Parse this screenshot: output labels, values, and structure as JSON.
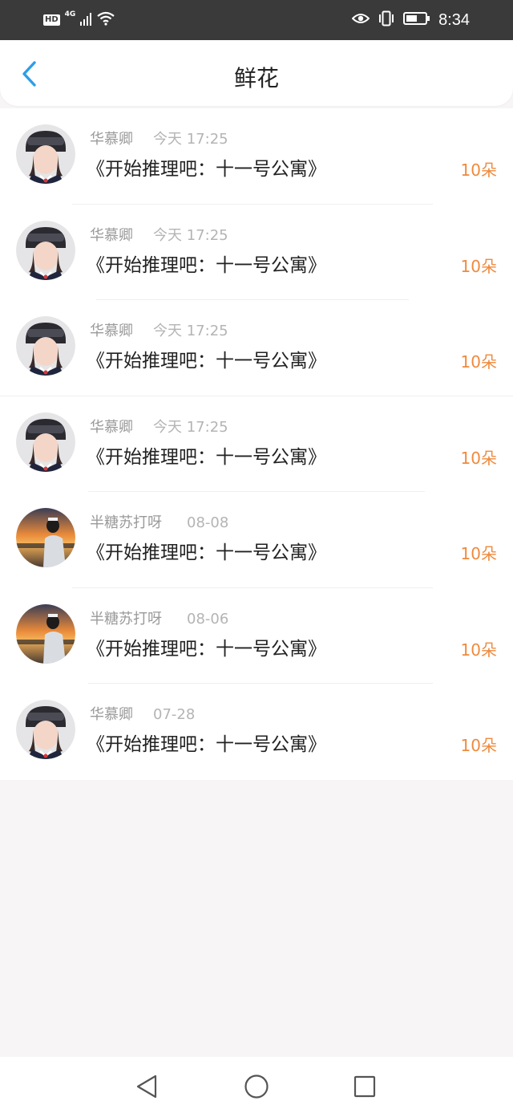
{
  "status_bar": {
    "hd_label": "HD",
    "network_label": "4G",
    "time": "8:34",
    "icons": [
      "signal-icon",
      "wifi-icon",
      "eye-comfort-icon",
      "vibrate-icon",
      "battery-icon"
    ]
  },
  "header": {
    "title": "鲜花",
    "back_icon": "chevron-left-icon",
    "accent_color": "#2d9ee8"
  },
  "records": [
    {
      "user": "华慕卿",
      "time": "今天 17:25",
      "book": "《开始推理吧：十一号公寓》",
      "amount": "10朵",
      "avatar": "girl-helmet-avatar"
    },
    {
      "user": "华慕卿",
      "time": "今天 17:25",
      "book": "《开始推理吧：十一号公寓》",
      "amount": "10朵",
      "avatar": "girl-helmet-avatar"
    },
    {
      "user": "华慕卿",
      "time": "今天 17:25",
      "book": "《开始推理吧：十一号公寓》",
      "amount": "10朵",
      "avatar": "girl-helmet-avatar"
    },
    {
      "user": "华慕卿",
      "time": "今天 17:25",
      "book": "《开始推理吧：十一号公寓》",
      "amount": "10朵",
      "avatar": "girl-helmet-avatar"
    },
    {
      "user": "半糖苏打呀",
      "time": "08-08",
      "book": "《开始推理吧：十一号公寓》",
      "amount": "10朵",
      "avatar": "sunset-photo-avatar"
    },
    {
      "user": "半糖苏打呀",
      "time": "08-06",
      "book": "《开始推理吧：十一号公寓》",
      "amount": "10朵",
      "avatar": "sunset-photo-avatar"
    },
    {
      "user": "华慕卿",
      "time": "07-28",
      "book": "《开始推理吧：十一号公寓》",
      "amount": "10朵",
      "avatar": "girl-helmet-avatar"
    }
  ],
  "colors": {
    "amount": "#ef8a3d",
    "username": "#9a9a9a",
    "timestamp": "#b4b4b4",
    "title_text": "#222222",
    "background": "#f7f5f6"
  },
  "nav_bar": {
    "icons": [
      "back-triangle-icon",
      "home-circle-icon",
      "recents-square-icon"
    ]
  }
}
